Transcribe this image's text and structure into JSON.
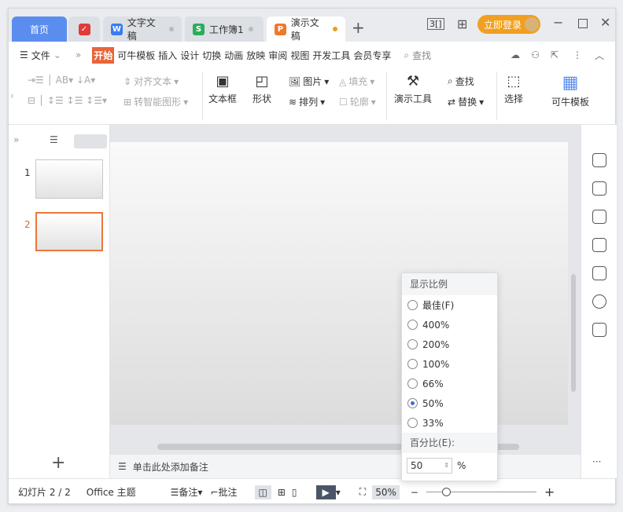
{
  "tabs": {
    "home": "首页",
    "items": [
      {
        "label": "文字文稿",
        "icon": "W",
        "color": "#3a7bf0"
      },
      {
        "label": "工作簿1",
        "icon": "S",
        "color": "#2aae5a"
      },
      {
        "label": "演示文稿",
        "icon": "P",
        "color": "#f0782a"
      }
    ],
    "new": "+"
  },
  "header": {
    "login": "立即登录",
    "layout_icon": "3[]"
  },
  "menu": {
    "file": "文件",
    "items": [
      "开始",
      "可牛模板",
      "插入",
      "设计",
      "切换",
      "动画",
      "放映",
      "审阅",
      "视图",
      "开发工具",
      "会员专享"
    ],
    "active": "开始",
    "search": "查找"
  },
  "ribbon": {
    "align_text": "对齐文本",
    "smart_shape": "转智能图形",
    "textbox": "文本框",
    "shape": "形状",
    "picture": "图片",
    "fill": "填充",
    "arrange": "排列",
    "outline": "轮廓",
    "present_tools": "演示工具",
    "find": "查找",
    "replace": "替换",
    "select": "选择",
    "template": "可牛模板"
  },
  "slides": [
    {
      "num": "1"
    },
    {
      "num": "2"
    }
  ],
  "notes": {
    "placeholder": "单击此处添加备注"
  },
  "status": {
    "slide": "幻灯片 2 / 2",
    "theme": "Office 主题",
    "notes": "备注",
    "comments": "批注",
    "zoom": "50%",
    "zoom_fraction": 0.5
  },
  "zoom_popup": {
    "title": "显示比例",
    "options": [
      "最佳(F)",
      "400%",
      "200%",
      "100%",
      "66%",
      "50%",
      "33%"
    ],
    "selected": "50%",
    "percent_label": "百分比(E):",
    "value": "50",
    "unit": "%"
  },
  "colors": {
    "accent": "#5b8def",
    "active_menu": "#e8653a",
    "login": "#f0a020"
  }
}
